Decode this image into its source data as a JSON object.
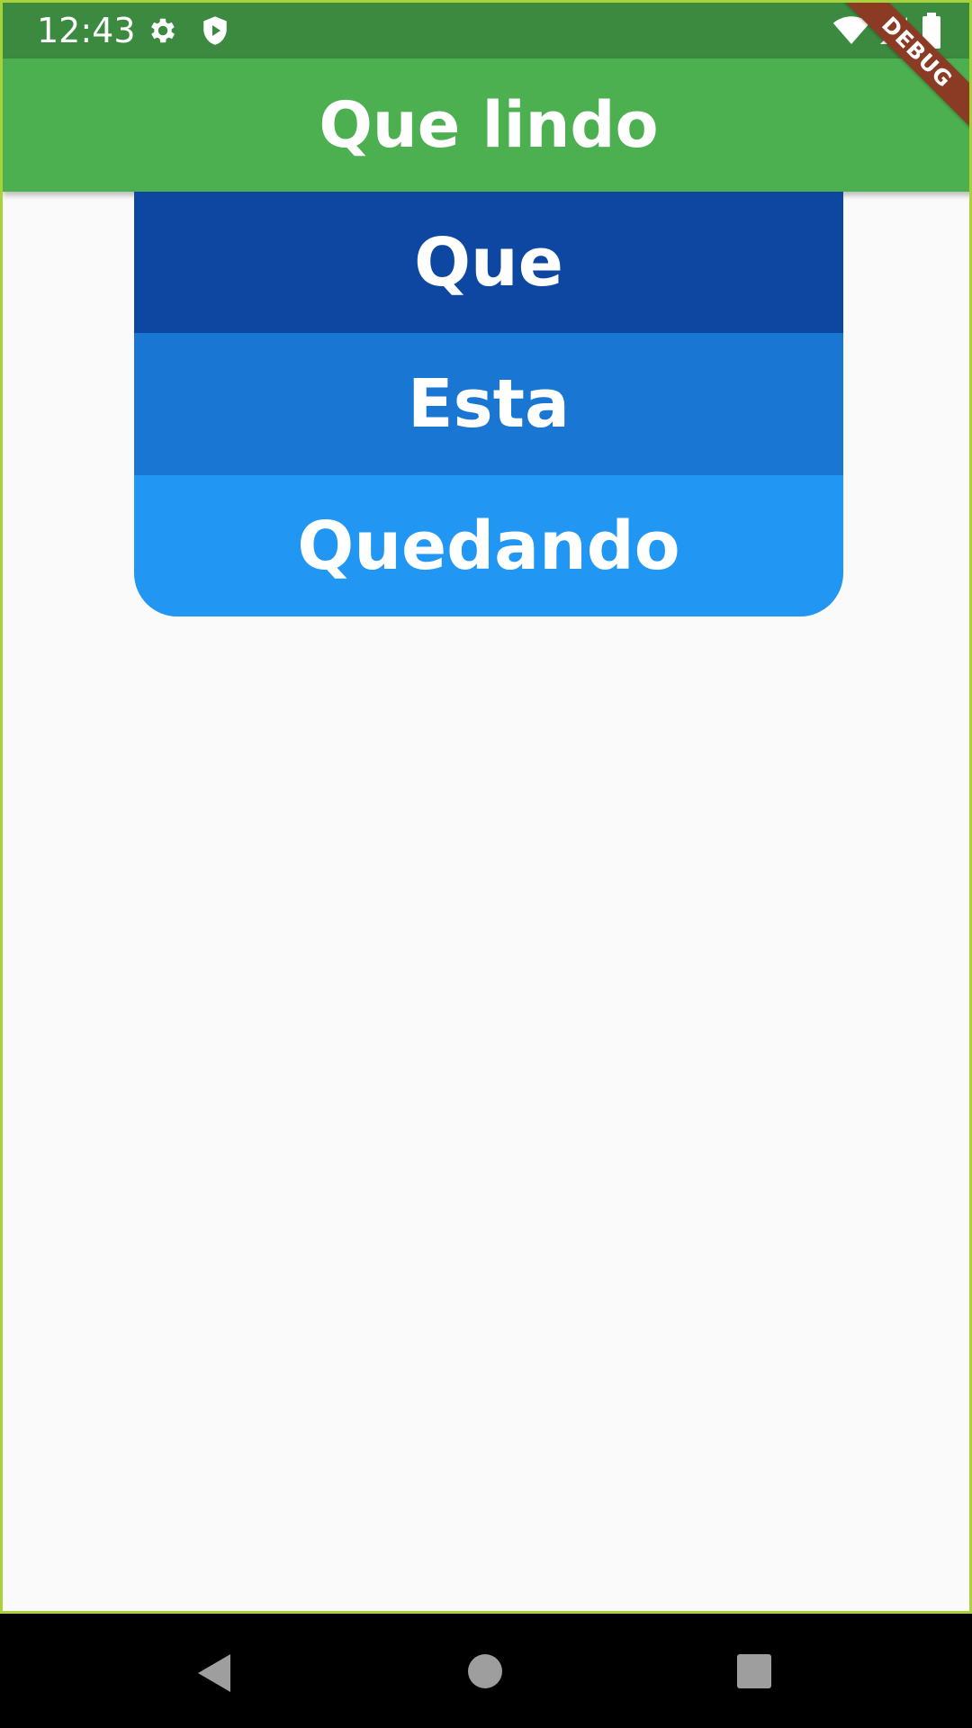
{
  "status_bar": {
    "time": "12:43",
    "icons": [
      "gear-icon",
      "shield-play-icon",
      "wifi-icon",
      "signal-icon",
      "battery-icon"
    ]
  },
  "app_bar": {
    "title": "Que lindo",
    "debug_banner": "DEBUG"
  },
  "list": {
    "items": [
      {
        "label": "Que",
        "color": "#0d47a1"
      },
      {
        "label": "Esta",
        "color": "#1976d2"
      },
      {
        "label": "Quedando",
        "color": "#2196f3"
      }
    ]
  },
  "nav_bar": {
    "buttons": [
      "back-icon",
      "home-icon",
      "recents-icon"
    ]
  },
  "colors": {
    "app_bar": "#4caf50",
    "status_bar": "#3b8a40",
    "background": "#fafafa"
  }
}
